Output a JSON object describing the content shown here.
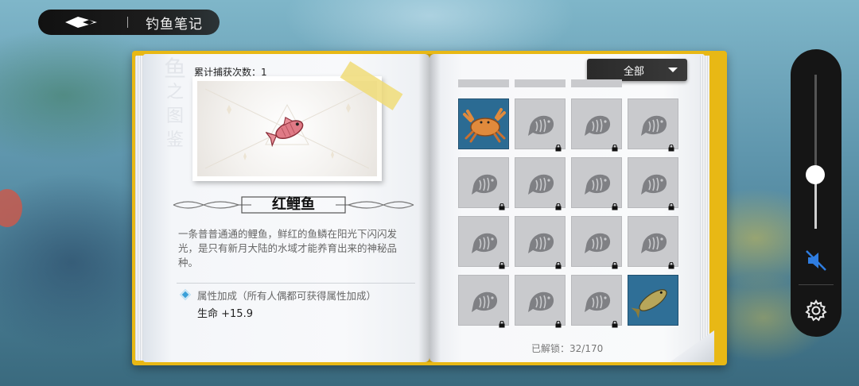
{
  "header": {
    "title": "钓鱼笔记"
  },
  "fish_detail": {
    "vertical_title": [
      "鱼",
      "之",
      "图",
      "鉴"
    ],
    "catch_count_label": "累计捕获次数：1",
    "name": "红鲤鱼",
    "description": "一条普普通通的鲤鱼，鲜红的鱼鳞在阳光下闪闪发光，是只有新月大陆的水域才能养育出来的神秘品种。",
    "bonus_title": "属性加成（所有人偶都可获得属性加成）",
    "bonus_value": "生命 +15.9"
  },
  "filter": {
    "selected": "全部"
  },
  "collection": {
    "unlock_label": "已解锁：32/170",
    "progress": {
      "unlocked": 32,
      "total": 170
    },
    "rows": [
      [
        "crab",
        "locked",
        "locked",
        "locked"
      ],
      [
        "locked",
        "locked",
        "locked",
        "locked"
      ],
      [
        "locked",
        "locked",
        "locked",
        "locked"
      ],
      [
        "locked",
        "locked",
        "locked",
        "carp"
      ]
    ]
  },
  "side_panel": {
    "volume_level": 0.35,
    "muted": true
  },
  "colors": {
    "book": "#e8b815",
    "owned_bg": "#2f6f97",
    "locked_bg": "#c9cacd"
  }
}
